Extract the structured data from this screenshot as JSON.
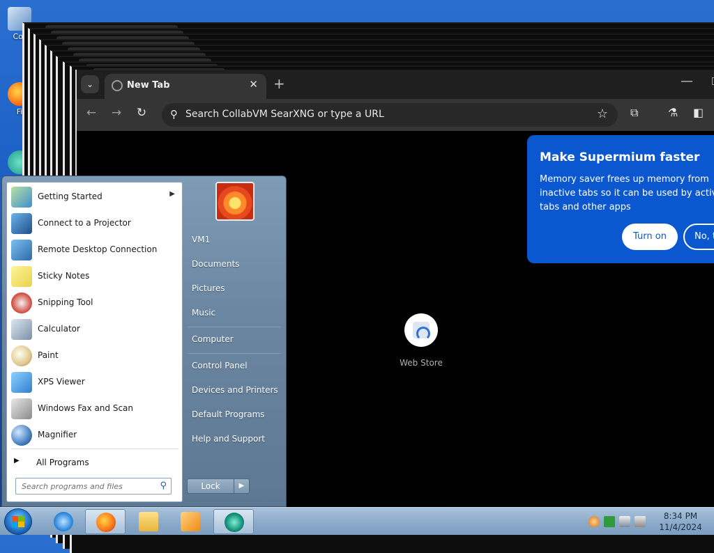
{
  "desktop": {
    "icons": [
      {
        "label": "Cor",
        "icon": "computer-icon"
      },
      {
        "label": "Fi",
        "icon": "firefox-icon"
      }
    ]
  },
  "browser": {
    "tab_title": "New Tab",
    "new_tab_symbol": "+",
    "close_symbol": "✕",
    "minimize_symbol": "—",
    "restore_symbol": "▯",
    "omnibox_placeholder": "Search CollabVM SearXNG or type a URL",
    "shortcut_label": "Web Store",
    "popup": {
      "title": "Make Supermium faster",
      "body": "Memory saver frees up memory from inactive tabs so it can be used by active tabs and other apps",
      "turn_on": "Turn on",
      "dismiss": "No, thanks"
    },
    "colors": {
      "popup_bg": "#0b57d0",
      "toolbar": "#353535",
      "tabstrip": "#1f1f1f"
    }
  },
  "start_menu": {
    "programs": [
      {
        "label": "Getting Started",
        "icon": "getting-started-icon",
        "arrow": "▶"
      },
      {
        "label": "Connect to a Projector",
        "icon": "projector-icon"
      },
      {
        "label": "Remote Desktop Connection",
        "icon": "remote-desktop-icon"
      },
      {
        "label": "Sticky Notes",
        "icon": "sticky-notes-icon"
      },
      {
        "label": "Snipping Tool",
        "icon": "snipping-tool-icon"
      },
      {
        "label": "Calculator",
        "icon": "calculator-icon"
      },
      {
        "label": "Paint",
        "icon": "paint-icon"
      },
      {
        "label": "XPS Viewer",
        "icon": "xps-viewer-icon"
      },
      {
        "label": "Windows Fax and Scan",
        "icon": "fax-scan-icon"
      },
      {
        "label": "Magnifier",
        "icon": "magnifier-icon"
      }
    ],
    "all_programs": "All Programs",
    "search_placeholder": "Search programs and files",
    "right_links": {
      "user": "VM1",
      "documents": "Documents",
      "pictures": "Pictures",
      "music": "Music",
      "computer": "Computer",
      "control_panel": "Control Panel",
      "devices": "Devices and Printers",
      "default_programs": "Default Programs",
      "help": "Help and Support"
    },
    "lock_label": "Lock",
    "lock_arrow": "▶"
  },
  "taskbar": {
    "apps": [
      "internet-explorer-icon",
      "firefox-icon",
      "explorer-icon",
      "media-player-icon",
      "supermium-icon"
    ],
    "time": "8:34 PM",
    "date": "11/4/2024"
  }
}
